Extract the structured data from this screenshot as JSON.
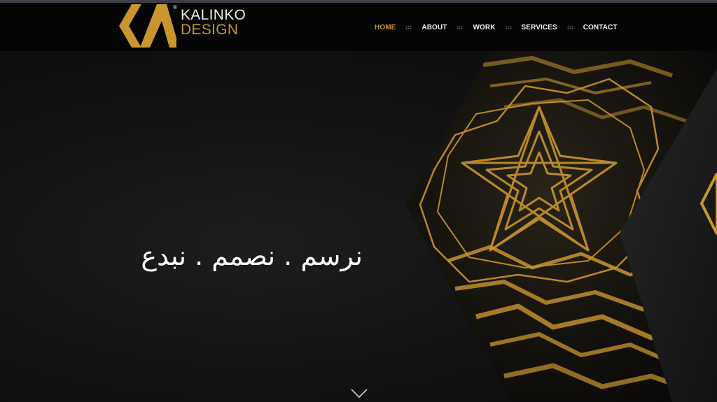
{
  "brand": {
    "name_line1": "KALINKO",
    "name_line2": "DESIGN",
    "registered": "®",
    "gold": "#c9952f"
  },
  "nav": {
    "items": [
      {
        "label": "HOME",
        "active": true
      },
      {
        "label": "ABOUT",
        "active": false
      },
      {
        "label": "WORK",
        "active": false
      },
      {
        "label": "SERVICES",
        "active": false
      },
      {
        "label": "CONTACT",
        "active": false
      }
    ]
  },
  "hero": {
    "tagline": "نرسم . نصمم . نبدع",
    "scroll_icon": "chevron-down-icon"
  }
}
